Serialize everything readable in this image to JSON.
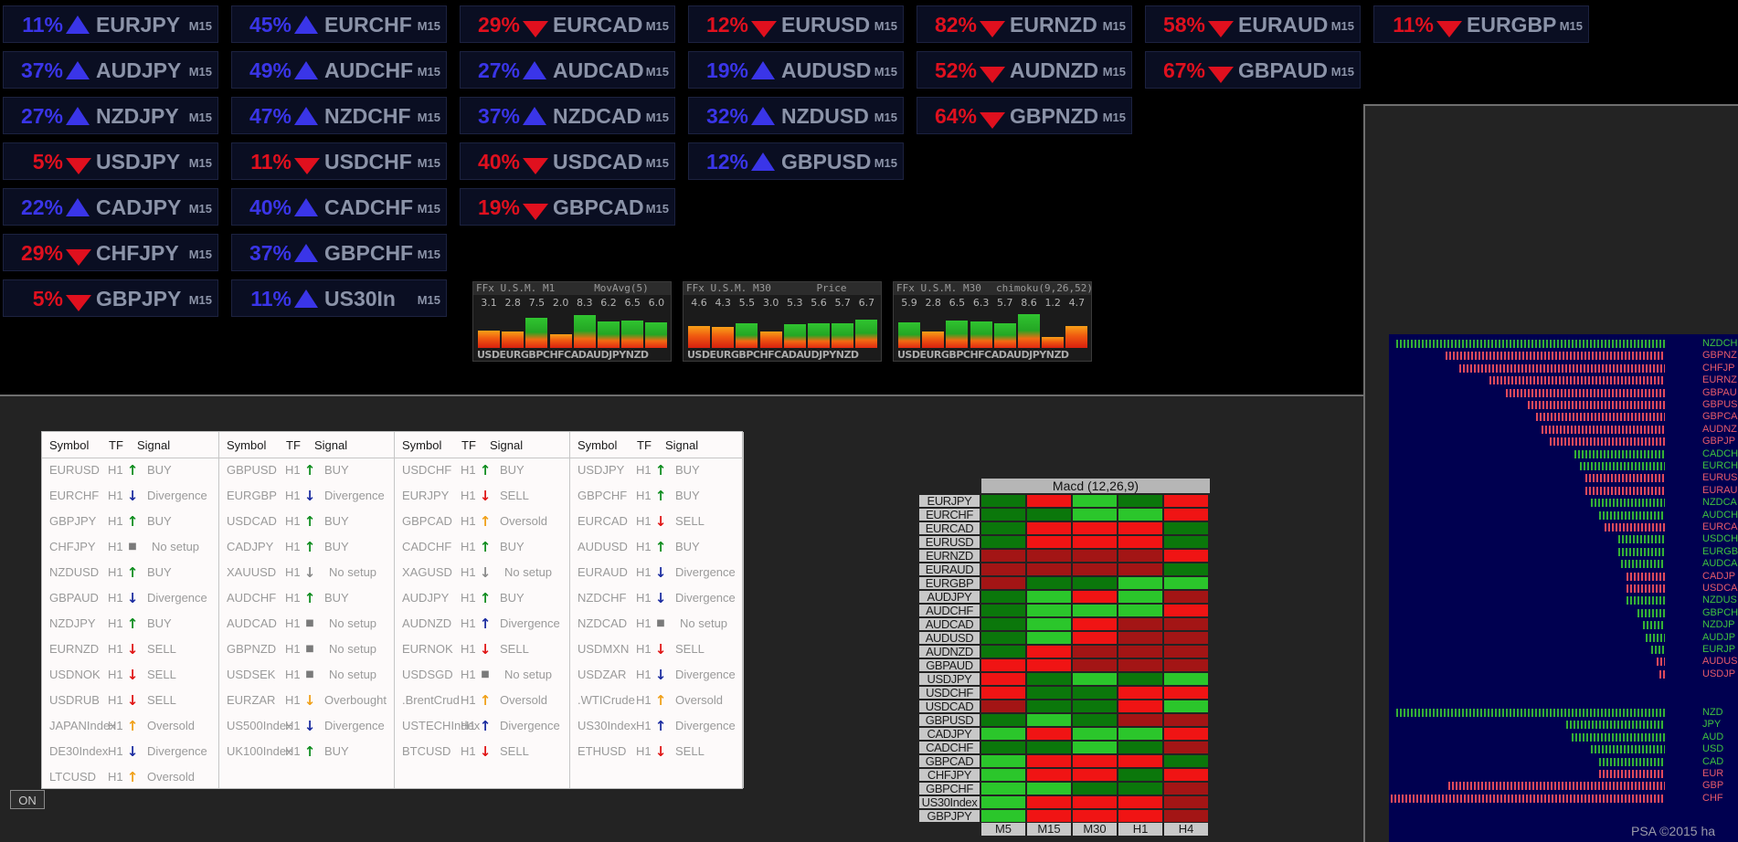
{
  "colors": {
    "up": "#3a35e8",
    "down": "#e0101e",
    "tile_text": "#8b93a8",
    "green": "#21b521",
    "red": "#c21414"
  },
  "tiles": [
    {
      "pct": "11%",
      "dir": "up",
      "sym": "EURJPY",
      "tf": "M15"
    },
    {
      "pct": "37%",
      "dir": "up",
      "sym": "AUDJPY",
      "tf": "M15"
    },
    {
      "pct": "27%",
      "dir": "up",
      "sym": "NZDJPY",
      "tf": "M15"
    },
    {
      "pct": "5%",
      "dir": "down",
      "sym": "USDJPY",
      "tf": "M15"
    },
    {
      "pct": "22%",
      "dir": "up",
      "sym": "CADJPY",
      "tf": "M15"
    },
    {
      "pct": "29%",
      "dir": "down",
      "sym": "CHFJPY",
      "tf": "M15"
    },
    {
      "pct": "5%",
      "dir": "down",
      "sym": "GBPJPY",
      "tf": "M15"
    },
    {
      "pct": "45%",
      "dir": "up",
      "sym": "EURCHF",
      "tf": "M15"
    },
    {
      "pct": "49%",
      "dir": "up",
      "sym": "AUDCHF",
      "tf": "M15"
    },
    {
      "pct": "47%",
      "dir": "up",
      "sym": "NZDCHF",
      "tf": "M15"
    },
    {
      "pct": "11%",
      "dir": "down",
      "sym": "USDCHF",
      "tf": "M15"
    },
    {
      "pct": "40%",
      "dir": "up",
      "sym": "CADCHF",
      "tf": "M15"
    },
    {
      "pct": "37%",
      "dir": "up",
      "sym": "GBPCHF",
      "tf": "M15"
    },
    {
      "pct": "11%",
      "dir": "up",
      "sym": "US30In",
      "tf": "M15"
    },
    {
      "pct": "29%",
      "dir": "down",
      "sym": "EURCAD",
      "tf": "M15"
    },
    {
      "pct": "27%",
      "dir": "up",
      "sym": "AUDCAD",
      "tf": "M15"
    },
    {
      "pct": "37%",
      "dir": "up",
      "sym": "NZDCAD",
      "tf": "M15"
    },
    {
      "pct": "40%",
      "dir": "down",
      "sym": "USDCAD",
      "tf": "M15"
    },
    {
      "pct": "19%",
      "dir": "down",
      "sym": "GBPCAD",
      "tf": "M15"
    },
    {
      "pct": "12%",
      "dir": "down",
      "sym": "EURUSD",
      "tf": "M15"
    },
    {
      "pct": "19%",
      "dir": "up",
      "sym": "AUDUSD",
      "tf": "M15"
    },
    {
      "pct": "32%",
      "dir": "up",
      "sym": "NZDUSD",
      "tf": "M15"
    },
    {
      "pct": "12%",
      "dir": "up",
      "sym": "GBPUSD",
      "tf": "M15"
    },
    {
      "pct": "82%",
      "dir": "down",
      "sym": "EURNZD",
      "tf": "M15"
    },
    {
      "pct": "52%",
      "dir": "down",
      "sym": "AUDNZD",
      "tf": "M15"
    },
    {
      "pct": "64%",
      "dir": "down",
      "sym": "GBPNZD",
      "tf": "M15"
    },
    {
      "pct": "58%",
      "dir": "down",
      "sym": "EURAUD",
      "tf": "M15"
    },
    {
      "pct": "67%",
      "dir": "down",
      "sym": "GBPAUD",
      "tf": "M15"
    },
    {
      "pct": "11%",
      "dir": "down",
      "sym": "EURGBP",
      "tf": "M15"
    }
  ],
  "usm": [
    {
      "title": "FFx U.S.M.",
      "tf": "M1",
      "ind": "MovAvg(5)",
      "vals": [
        "3.1",
        "2.8",
        "7.5",
        "2.0",
        "8.3",
        "6.2",
        "6.5",
        "6.0"
      ],
      "levels": [
        0.31,
        0.28,
        0.75,
        0.2,
        0.83,
        0.62,
        0.65,
        0.6
      ],
      "currencies": "USDEURGBPCHFCADAUDJPYNZD"
    },
    {
      "title": "FFx U.S.M.",
      "tf": "M30",
      "ind": "Price",
      "vals": [
        "4.6",
        "4.3",
        "5.5",
        "3.0",
        "5.3",
        "5.6",
        "5.7",
        "6.7"
      ],
      "levels": [
        0.46,
        0.43,
        0.55,
        0.3,
        0.53,
        0.56,
        0.57,
        0.67
      ],
      "currencies": "USDEURGBPCHFCADAUDJPYNZD"
    },
    {
      "title": "FFx U.S.M.",
      "tf": "M30",
      "ind": "chimoku(9,26,52)",
      "vals": [
        "5.9",
        "2.8",
        "6.5",
        "6.3",
        "5.7",
        "8.6",
        "1.2",
        "4.7"
      ],
      "levels": [
        0.59,
        0.28,
        0.65,
        0.63,
        0.57,
        0.86,
        0.12,
        0.47
      ],
      "currencies": "USDEURGBPCHFCADAUDJPYNZD"
    }
  ],
  "signal_table": {
    "headers": {
      "symbol": "Symbol",
      "tf": "TF",
      "signal": "Signal"
    },
    "columns": [
      [
        {
          "sym": "EURUSD",
          "tf": "H1",
          "arrow": "up",
          "sig": "BUY"
        },
        {
          "sym": "EURCHF",
          "tf": "H1",
          "arrow": "div",
          "sig": "Divergence"
        },
        {
          "sym": "GBPJPY",
          "tf": "H1",
          "arrow": "up",
          "sig": "BUY"
        },
        {
          "sym": "CHFJPY",
          "tf": "H1",
          "arrow": "none",
          "sig": "No setup"
        },
        {
          "sym": "NZDUSD",
          "tf": "H1",
          "arrow": "up",
          "sig": "BUY"
        },
        {
          "sym": "GBPAUD",
          "tf": "H1",
          "arrow": "div",
          "sig": "Divergence"
        },
        {
          "sym": "NZDJPY",
          "tf": "H1",
          "arrow": "up",
          "sig": "BUY"
        },
        {
          "sym": "EURNZD",
          "tf": "H1",
          "arrow": "down",
          "sig": "SELL"
        },
        {
          "sym": "USDNOK",
          "tf": "H1",
          "arrow": "down",
          "sig": "SELL"
        },
        {
          "sym": "USDRUB",
          "tf": "H1",
          "arrow": "down",
          "sig": "SELL"
        },
        {
          "sym": "JAPANIndex",
          "tf": "H1",
          "arrow": "os",
          "sig": "Oversold"
        },
        {
          "sym": "DE30Index",
          "tf": "H1",
          "arrow": "div",
          "sig": "Divergence"
        },
        {
          "sym": "LTCUSD",
          "tf": "H1",
          "arrow": "os",
          "sig": "Oversold"
        }
      ],
      [
        {
          "sym": "GBPUSD",
          "tf": "H1",
          "arrow": "up",
          "sig": "BUY"
        },
        {
          "sym": "EURGBP",
          "tf": "H1",
          "arrow": "div",
          "sig": "Divergence"
        },
        {
          "sym": "USDCAD",
          "tf": "H1",
          "arrow": "up",
          "sig": "BUY"
        },
        {
          "sym": "CADJPY",
          "tf": "H1",
          "arrow": "up",
          "sig": "BUY"
        },
        {
          "sym": "XAUUSD",
          "tf": "H1",
          "arrow": "nsdown",
          "sig": "No setup"
        },
        {
          "sym": "AUDCHF",
          "tf": "H1",
          "arrow": "up",
          "sig": "BUY"
        },
        {
          "sym": "AUDCAD",
          "tf": "H1",
          "arrow": "none",
          "sig": "No setup"
        },
        {
          "sym": "GBPNZD",
          "tf": "H1",
          "arrow": "none",
          "sig": "No setup"
        },
        {
          "sym": "USDSEK",
          "tf": "H1",
          "arrow": "none",
          "sig": "No setup"
        },
        {
          "sym": "EURZAR",
          "tf": "H1",
          "arrow": "ob",
          "sig": "Overbought"
        },
        {
          "sym": "US500Index",
          "tf": "H1",
          "arrow": "div",
          "sig": "Divergence"
        },
        {
          "sym": "UK100Index",
          "tf": "H1",
          "arrow": "up",
          "sig": "BUY"
        }
      ],
      [
        {
          "sym": "USDCHF",
          "tf": "H1",
          "arrow": "up",
          "sig": "BUY"
        },
        {
          "sym": "EURJPY",
          "tf": "H1",
          "arrow": "down",
          "sig": "SELL"
        },
        {
          "sym": "GBPCAD",
          "tf": "H1",
          "arrow": "os",
          "sig": "Oversold"
        },
        {
          "sym": "CADCHF",
          "tf": "H1",
          "arrow": "up",
          "sig": "BUY"
        },
        {
          "sym": "XAGUSD",
          "tf": "H1",
          "arrow": "nsdown",
          "sig": "No setup"
        },
        {
          "sym": "AUDJPY",
          "tf": "H1",
          "arrow": "up",
          "sig": "BUY"
        },
        {
          "sym": "AUDNZD",
          "tf": "H1",
          "arrow": "divup",
          "sig": "Divergence"
        },
        {
          "sym": "EURNOK",
          "tf": "H1",
          "arrow": "down",
          "sig": "SELL"
        },
        {
          "sym": "USDSGD",
          "tf": "H1",
          "arrow": "none",
          "sig": "No setup"
        },
        {
          "sym": ".BrentCrud",
          "tf": "H1",
          "arrow": "os",
          "sig": "Oversold"
        },
        {
          "sym": "USTECHIndex",
          "tf": "H1",
          "arrow": "divup",
          "sig": "Divergence"
        },
        {
          "sym": "BTCUSD",
          "tf": "H1",
          "arrow": "down",
          "sig": "SELL"
        }
      ],
      [
        {
          "sym": "USDJPY",
          "tf": "H1",
          "arrow": "up",
          "sig": "BUY"
        },
        {
          "sym": "GBPCHF",
          "tf": "H1",
          "arrow": "up",
          "sig": "BUY"
        },
        {
          "sym": "EURCAD",
          "tf": "H1",
          "arrow": "down",
          "sig": "SELL"
        },
        {
          "sym": "AUDUSD",
          "tf": "H1",
          "arrow": "up",
          "sig": "BUY"
        },
        {
          "sym": "EURAUD",
          "tf": "H1",
          "arrow": "div",
          "sig": "Divergence"
        },
        {
          "sym": "NZDCHF",
          "tf": "H1",
          "arrow": "div",
          "sig": "Divergence"
        },
        {
          "sym": "NZDCAD",
          "tf": "H1",
          "arrow": "none",
          "sig": "No setup"
        },
        {
          "sym": "USDMXN",
          "tf": "H1",
          "arrow": "down",
          "sig": "SELL"
        },
        {
          "sym": "USDZAR",
          "tf": "H1",
          "arrow": "div",
          "sig": "Divergence"
        },
        {
          "sym": ".WTICrude",
          "tf": "H1",
          "arrow": "os",
          "sig": "Oversold"
        },
        {
          "sym": "US30Index",
          "tf": "H1",
          "arrow": "divup",
          "sig": "Divergence"
        },
        {
          "sym": "ETHUSD",
          "tf": "H1",
          "arrow": "down",
          "sig": "SELL"
        }
      ]
    ]
  },
  "on_button": "ON",
  "macd": {
    "title": "Macd (12,26,9)",
    "timeframes": [
      "M5",
      "M15",
      "M30",
      "H1",
      "H4"
    ],
    "rows": [
      {
        "sym": "EURJPY",
        "cells": [
          "g",
          "R",
          "G",
          "g",
          "R"
        ]
      },
      {
        "sym": "EURCHF",
        "cells": [
          "g",
          "g",
          "G",
          "G",
          "R"
        ]
      },
      {
        "sym": "EURCAD",
        "cells": [
          "g",
          "R",
          "R",
          "R",
          "g"
        ]
      },
      {
        "sym": "EURUSD",
        "cells": [
          "g",
          "R",
          "R",
          "R",
          "g"
        ]
      },
      {
        "sym": "EURNZD",
        "cells": [
          "r",
          "r",
          "r",
          "r",
          "R"
        ]
      },
      {
        "sym": "EURAUD",
        "cells": [
          "r",
          "r",
          "r",
          "r",
          "g"
        ]
      },
      {
        "sym": "EURGBP",
        "cells": [
          "r",
          "g",
          "g",
          "G",
          "G"
        ]
      },
      {
        "sym": "AUDJPY",
        "cells": [
          "g",
          "G",
          "R",
          "G",
          "r"
        ]
      },
      {
        "sym": "AUDCHF",
        "cells": [
          "g",
          "G",
          "G",
          "G",
          "R"
        ]
      },
      {
        "sym": "AUDCAD",
        "cells": [
          "g",
          "G",
          "R",
          "r",
          "r"
        ]
      },
      {
        "sym": "AUDUSD",
        "cells": [
          "g",
          "G",
          "R",
          "r",
          "r"
        ]
      },
      {
        "sym": "AUDNZD",
        "cells": [
          "g",
          "R",
          "r",
          "r",
          "r"
        ]
      },
      {
        "sym": "GBPAUD",
        "cells": [
          "R",
          "R",
          "r",
          "r",
          "r"
        ]
      },
      {
        "sym": "USDJPY",
        "cells": [
          "R",
          "g",
          "G",
          "g",
          "G"
        ]
      },
      {
        "sym": "USDCHF",
        "cells": [
          "R",
          "g",
          "g",
          "R",
          "R"
        ]
      },
      {
        "sym": "USDCAD",
        "cells": [
          "r",
          "g",
          "g",
          "R",
          "G"
        ]
      },
      {
        "sym": "GBPUSD",
        "cells": [
          "g",
          "G",
          "g",
          "r",
          "r"
        ]
      },
      {
        "sym": "CADJPY",
        "cells": [
          "G",
          "R",
          "G",
          "G",
          "R"
        ]
      },
      {
        "sym": "CADCHF",
        "cells": [
          "g",
          "g",
          "G",
          "g",
          "r"
        ]
      },
      {
        "sym": "GBPCAD",
        "cells": [
          "G",
          "R",
          "R",
          "R",
          "g"
        ]
      },
      {
        "sym": "CHFJPY",
        "cells": [
          "G",
          "R",
          "R",
          "g",
          "R"
        ]
      },
      {
        "sym": "GBPCHF",
        "cells": [
          "G",
          "G",
          "g",
          "g",
          "r"
        ]
      },
      {
        "sym": "US30Index",
        "cells": [
          "G",
          "R",
          "R",
          "R",
          "r"
        ]
      },
      {
        "sym": "GBPJPY",
        "cells": [
          "G",
          "R",
          "R",
          "R",
          "r"
        ]
      }
    ]
  },
  "strength": {
    "group1": [
      {
        "nm": "NZDCH",
        "c": "g",
        "len": 0.98
      },
      {
        "nm": "GBPNZ",
        "c": "r",
        "len": 0.8
      },
      {
        "nm": "CHFJP",
        "c": "r",
        "len": 0.75
      },
      {
        "nm": "EURNZ",
        "c": "r",
        "len": 0.64
      },
      {
        "nm": "GBPAU",
        "c": "r",
        "len": 0.58
      },
      {
        "nm": "GBPUS",
        "c": "r",
        "len": 0.5
      },
      {
        "nm": "GBPCA",
        "c": "r",
        "len": 0.47
      },
      {
        "nm": "AUDNZ",
        "c": "r",
        "len": 0.45
      },
      {
        "nm": "GBPJP",
        "c": "r",
        "len": 0.42
      },
      {
        "nm": "CADCH",
        "c": "g",
        "len": 0.33
      },
      {
        "nm": "EURCH",
        "c": "g",
        "len": 0.31
      },
      {
        "nm": "EURUS",
        "c": "r",
        "len": 0.29
      },
      {
        "nm": "EURAU",
        "c": "r",
        "len": 0.29
      },
      {
        "nm": "NZDCA",
        "c": "g",
        "len": 0.27
      },
      {
        "nm": "AUDCH",
        "c": "g",
        "len": 0.24
      },
      {
        "nm": "EURCA",
        "c": "r",
        "len": 0.22
      },
      {
        "nm": "USDCH",
        "c": "g",
        "len": 0.17
      },
      {
        "nm": "EURGB",
        "c": "g",
        "len": 0.17
      },
      {
        "nm": "AUDCA",
        "c": "g",
        "len": 0.16
      },
      {
        "nm": "CADJP",
        "c": "r",
        "len": 0.14
      },
      {
        "nm": "USDCA",
        "c": "r",
        "len": 0.14
      },
      {
        "nm": "NZDUS",
        "c": "g",
        "len": 0.14
      },
      {
        "nm": "GBPCH",
        "c": "g",
        "len": 0.1
      },
      {
        "nm": "NZDJP",
        "c": "g",
        "len": 0.08
      },
      {
        "nm": "AUDJP",
        "c": "g",
        "len": 0.07
      },
      {
        "nm": "EURJP",
        "c": "g",
        "len": 0.05
      },
      {
        "nm": "AUDUS",
        "c": "r",
        "len": 0.03
      },
      {
        "nm": "USDJP",
        "c": "r",
        "len": 0.02
      }
    ],
    "group2": [
      {
        "nm": "NZD",
        "c": "g",
        "len": 0.98
      },
      {
        "nm": "JPY",
        "c": "g",
        "len": 0.36
      },
      {
        "nm": "AUD",
        "c": "g",
        "len": 0.34
      },
      {
        "nm": "USD",
        "c": "g",
        "len": 0.27
      },
      {
        "nm": "CAD",
        "c": "g",
        "len": 0.24
      },
      {
        "nm": "EUR",
        "c": "r",
        "len": 0.24
      },
      {
        "nm": "GBP",
        "c": "r",
        "len": 0.79
      },
      {
        "nm": "CHF",
        "c": "r",
        "len": 1.0
      }
    ]
  },
  "copyright": "PSA ©2015 ha"
}
